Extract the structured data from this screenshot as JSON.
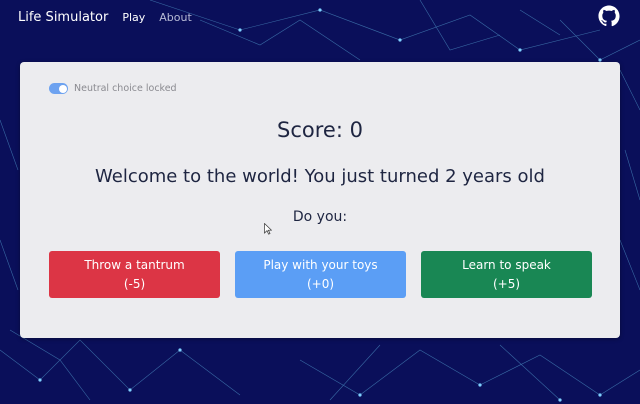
{
  "navbar": {
    "brand": "Life Simulator",
    "links": [
      {
        "label": "Play",
        "active": true
      },
      {
        "label": "About",
        "active": false
      }
    ],
    "github_icon": "github-icon"
  },
  "settings": {
    "neutral_lock_label": "Neutral choice locked",
    "neutral_lock_on": true
  },
  "game": {
    "score_text": "Score: 0",
    "message": "Welcome to the world! You just turned 2 years old",
    "prompt": "Do you:",
    "choices": [
      {
        "label": "Throw a tantrum",
        "delta": "(-5)",
        "color": "#dc3545"
      },
      {
        "label": "Play with your toys",
        "delta": "(+0)",
        "color": "#5b9ef5"
      },
      {
        "label": "Learn to speak",
        "delta": "(+5)",
        "color": "#198754"
      }
    ]
  },
  "colors": {
    "background": "#0a0f5a",
    "card": "#ececef",
    "text": "#1e2541"
  }
}
